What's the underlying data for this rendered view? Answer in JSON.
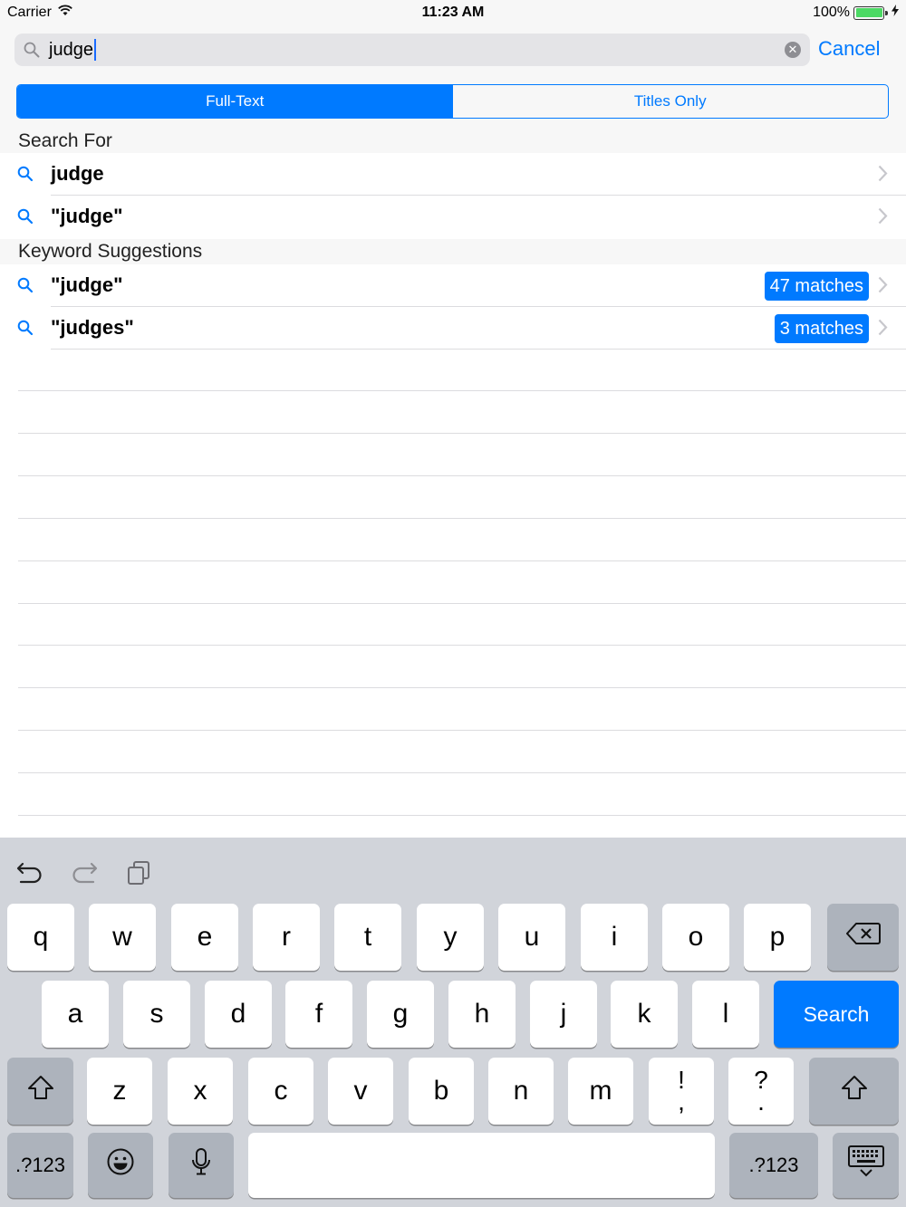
{
  "status_bar": {
    "carrier": "Carrier",
    "time": "11:23 AM",
    "battery": "100%",
    "battery_level": 1.0
  },
  "search": {
    "query": "judge",
    "cancel_label": "Cancel",
    "icon": "magnifier-icon",
    "clear_icon": "clear-x-icon"
  },
  "scope": {
    "options": [
      "Full-Text",
      "Titles Only"
    ],
    "selected": "Full-Text"
  },
  "search_for": {
    "header": "Search For",
    "items": [
      {
        "text": "judge"
      },
      {
        "text": "\"judge\""
      }
    ]
  },
  "keyword_suggestions": {
    "header": "Keyword Suggestions",
    "items": [
      {
        "text": "\"judge\"",
        "badge": "47 matches"
      },
      {
        "text": "\"judges\"",
        "badge": "3 matches"
      }
    ]
  },
  "keyboard": {
    "toolbar": [
      "undo-icon",
      "redo-icon",
      "paste-icon"
    ],
    "row1": [
      "q",
      "w",
      "e",
      "r",
      "t",
      "y",
      "u",
      "i",
      "o",
      "p"
    ],
    "row2": [
      "a",
      "s",
      "d",
      "f",
      "g",
      "h",
      "j",
      "k",
      "l"
    ],
    "row3": [
      "z",
      "x",
      "c",
      "v",
      "b",
      "n",
      "m"
    ],
    "punct1": {
      "top": "!",
      "bottom": ","
    },
    "punct2": {
      "top": "?",
      "bottom": "."
    },
    "search_label": "Search",
    "numbers_label": ".?123",
    "accent_color": "#007aff"
  }
}
